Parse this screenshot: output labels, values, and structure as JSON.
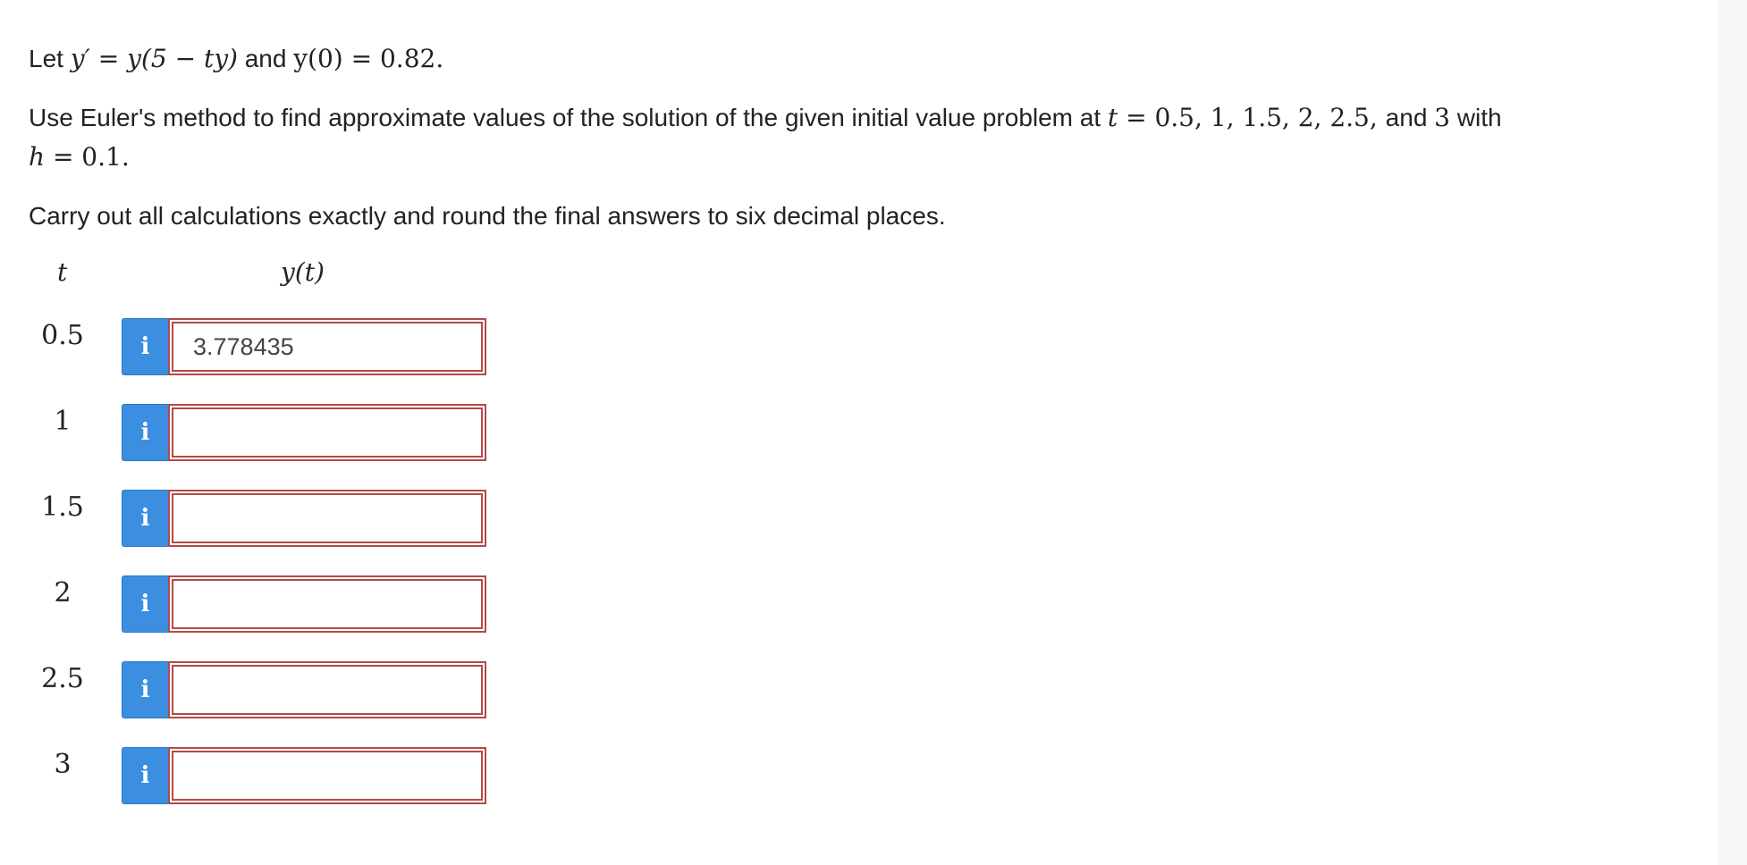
{
  "problem": {
    "intro_prefix": "Let ",
    "ode": "y′ = y(5 − ty)",
    "and_word": " and ",
    "initial_condition": "y(0) = 0.82.",
    "instruction_prefix": "Use Euler's method to find approximate values of the solution of the given initial value problem at ",
    "t_var": "t",
    "t_values": " = 0.5, 1, 1.5, 2, 2.5, ",
    "and_3": " and ",
    "three": "3",
    "with_word": " with",
    "h_var": "h",
    "h_value": " = 0.1.",
    "rounding_instruction": "Carry out all calculations exactly and round the final answers to six decimal places."
  },
  "table": {
    "col_t_header": "t",
    "col_y_header": "y(t)",
    "info_icon_label": "i",
    "rows": [
      {
        "t": "0.5",
        "answer": "3.778435"
      },
      {
        "t": "1",
        "answer": ""
      },
      {
        "t": "1.5",
        "answer": ""
      },
      {
        "t": "2",
        "answer": ""
      },
      {
        "t": "2.5",
        "answer": ""
      },
      {
        "t": "3",
        "answer": ""
      }
    ]
  },
  "colors": {
    "info_button": "#3b8ee0",
    "input_border": "#b04a4a"
  }
}
